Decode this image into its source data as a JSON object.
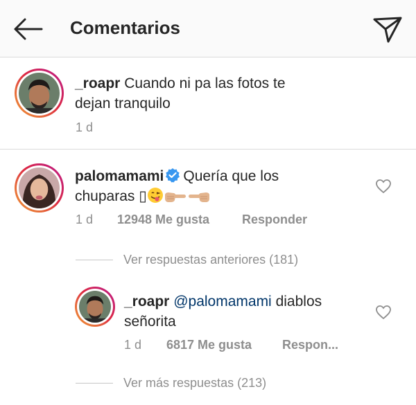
{
  "header": {
    "title": "Comentarios"
  },
  "caption": {
    "username": "_roapr",
    "text_line1": "Cuando ni pa las fotos te",
    "text_line2": "dejan tranquilo",
    "time": "1 d"
  },
  "comment": {
    "username": "palomamami",
    "text_line1": "Quería que los",
    "text_line2": "chuparas",
    "missing_glyph": "▯",
    "time": "1 d",
    "likes": "12948 Me gusta",
    "reply_label": "Responder"
  },
  "view_previous": "Ver respuestas anteriores (181)",
  "reply": {
    "username": "_roapr",
    "mention": "@palomamami",
    "text_line1_rest": "diablos",
    "text_line2": "señorita",
    "time": "1 d",
    "likes": "6817 Me gusta",
    "reply_label": "Respon..."
  },
  "view_more": "Ver más respuestas (213)",
  "colors": {
    "verified": "#3897f0",
    "mention": "#003569",
    "meta_gray": "#8e8e8e"
  }
}
